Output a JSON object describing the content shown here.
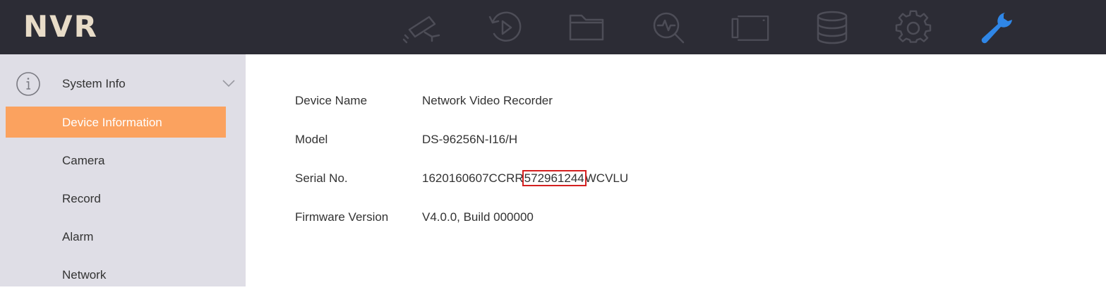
{
  "header": {
    "logo": "NVR",
    "nav_icons": [
      "live-view-camera-icon",
      "playback-icon",
      "file-folder-icon",
      "smart-search-icon",
      "camera-management-icon",
      "storage-icon",
      "configuration-gear-icon",
      "maintenance-wrench-icon"
    ],
    "active_icon": "maintenance-wrench-icon",
    "active_color": "#2f86e6",
    "inactive_color": "#4d4d57"
  },
  "sidebar": {
    "group_label": "System Info",
    "items": [
      {
        "label": "Device Information",
        "active": true
      },
      {
        "label": "Camera",
        "active": false
      },
      {
        "label": "Record",
        "active": false
      },
      {
        "label": "Alarm",
        "active": false
      },
      {
        "label": "Network",
        "active": false
      }
    ],
    "active_color": "#fba25f"
  },
  "device_info": {
    "device_name_label": "Device Name",
    "device_name_value": "Network Video Recorder",
    "model_label": "Model",
    "model_value": "DS-96256N-I16/H",
    "serial_label": "Serial No.",
    "serial_prefix": "1620160607CCRR",
    "serial_highlight": "572961244",
    "serial_suffix": "WCVLU",
    "firmware_label": "Firmware Version",
    "firmware_value": "V4.0.0, Build 000000"
  }
}
